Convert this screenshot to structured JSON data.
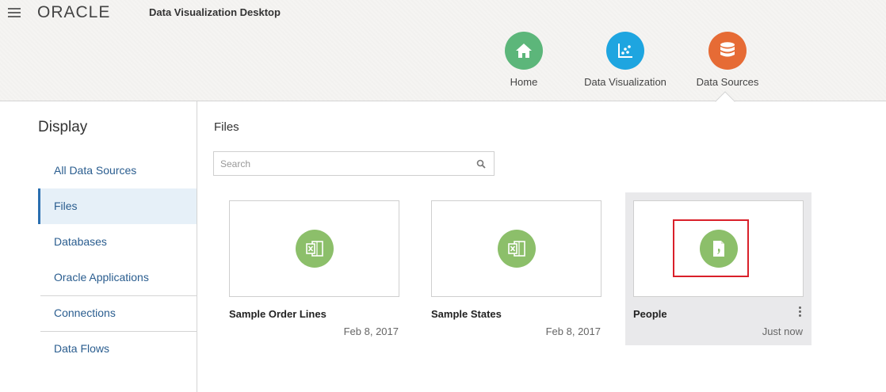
{
  "header": {
    "logo_text": "ORACLE",
    "app_title": "Data Visualization Desktop",
    "nav": [
      {
        "label": "Home",
        "color": "#5cb67a",
        "icon": "home-icon"
      },
      {
        "label": "Data Visualization",
        "color": "#1ea5e0",
        "icon": "scatter-chart-icon"
      },
      {
        "label": "Data Sources",
        "color": "#e66b35",
        "icon": "database-icon"
      }
    ],
    "active_nav": "Data Sources"
  },
  "sidebar": {
    "title": "Display",
    "items": [
      {
        "label": "All Data Sources"
      },
      {
        "label": "Files",
        "active": true
      },
      {
        "label": "Databases"
      },
      {
        "label": "Oracle Applications"
      },
      {
        "label": "Connections"
      },
      {
        "label": "Data Flows"
      }
    ]
  },
  "main": {
    "title": "Files",
    "search": {
      "placeholder": "Search",
      "value": ""
    },
    "files": [
      {
        "name": "Sample Order Lines",
        "date": "Feb 8, 2017",
        "icon": "excel-file-icon"
      },
      {
        "name": "Sample States",
        "date": "Feb 8, 2017",
        "icon": "excel-file-icon"
      },
      {
        "name": "People",
        "date": "Just now",
        "icon": "csv-file-icon",
        "selected": true
      }
    ]
  },
  "colors": {
    "accent": "#2a6fb0",
    "file_icon_bg": "#8cbf6a",
    "highlight": "#d9202a"
  }
}
